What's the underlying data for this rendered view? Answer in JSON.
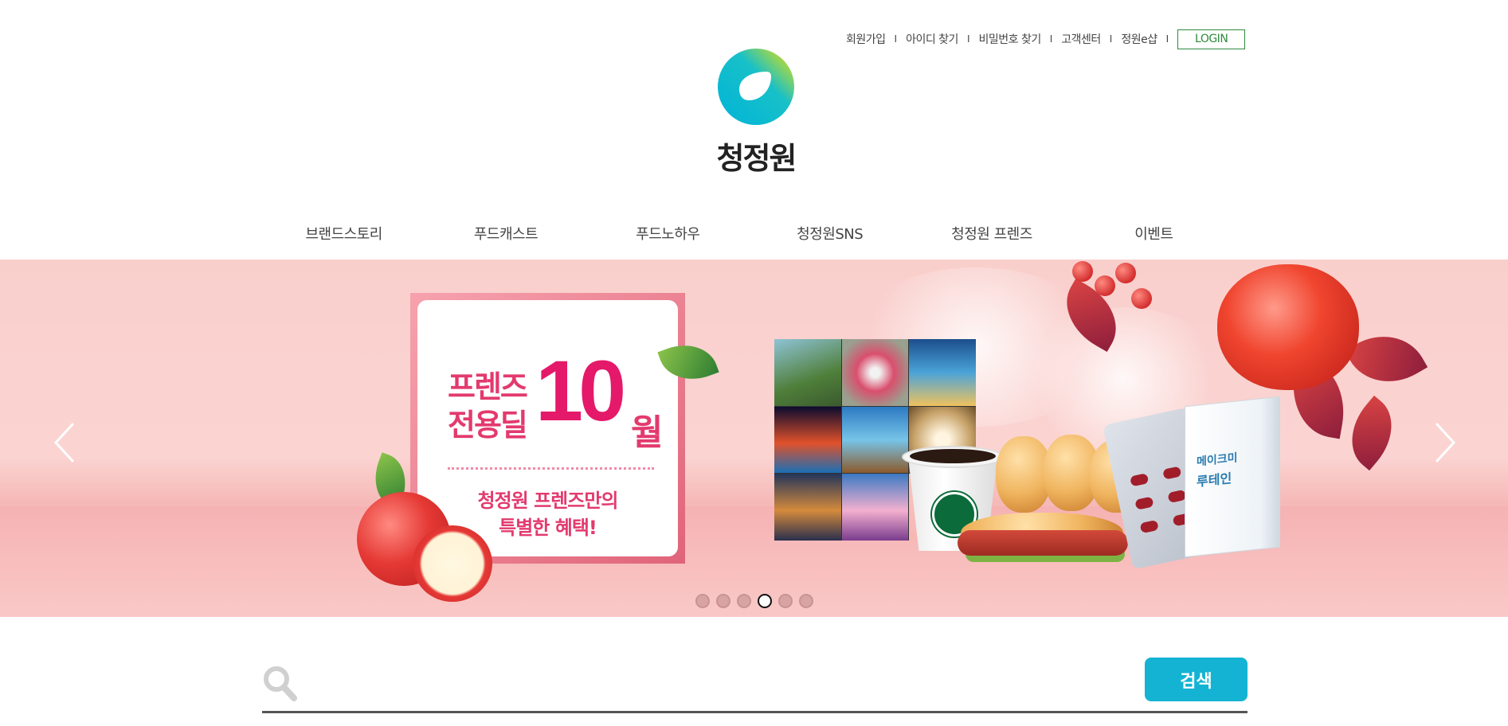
{
  "util_links": [
    "회원가입",
    "아이디 찾기",
    "비밀번호 찾기",
    "고객센터",
    "정원e샵"
  ],
  "util_separator": "I",
  "login_label": "LOGIN",
  "logo_text": "청정원",
  "nav_items": [
    "브랜드스토리",
    "푸드캐스트",
    "푸드노하우",
    "청정원SNS",
    "청정원 프렌즈",
    "이벤트"
  ],
  "banner": {
    "title_line1": "프렌즈",
    "title_line2": "전용딜",
    "big_number": "10",
    "month": "월",
    "subtitle_line1": "청정원 프렌즈만의",
    "subtitle_line2": "특별한 혜택!",
    "box_label1": "메이크미",
    "box_label2": "루테인",
    "slide_count": 6,
    "active_slide": 4
  },
  "search": {
    "input_value": "",
    "button_label": "검색"
  },
  "colors": {
    "login_border": "#2e8b3d",
    "search_button": "#14b3d3",
    "promo_pink": "#e5196a",
    "banner_bg": "#f9cfcc"
  }
}
